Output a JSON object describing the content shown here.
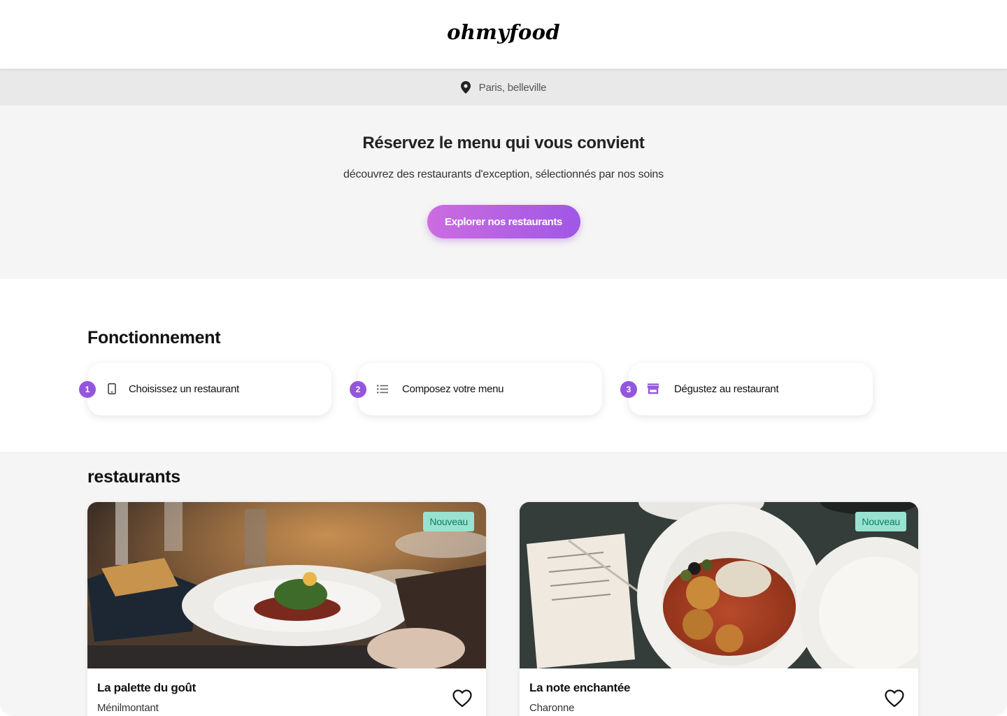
{
  "header": {
    "logo": "ohmyfood"
  },
  "location": {
    "text": "Paris, belleville",
    "icon": "location-pin-icon"
  },
  "hero": {
    "title": "Réservez le menu qui vous convient",
    "subtitle": "découvrez des restaurants d'exception, sélectionnés par nos soins",
    "cta": "Explorer nos restaurants"
  },
  "how": {
    "title": "Fonctionnement",
    "steps": [
      {
        "number": "1",
        "icon": "phone-icon",
        "label": "Choisissez un restaurant"
      },
      {
        "number": "2",
        "icon": "list-icon",
        "label": "Composez votre menu"
      },
      {
        "number": "3",
        "icon": "store-icon",
        "label": "Dégustez au restaurant"
      }
    ]
  },
  "restaurants": {
    "title": "restaurants",
    "items": [
      {
        "name": "La palette du goût",
        "location": "Ménilmontant",
        "badge": "Nouveau",
        "favorite_icon": "heart-icon"
      },
      {
        "name": "La note enchantée",
        "location": "Charonne",
        "badge": "Nouveau",
        "favorite_icon": "heart-icon"
      }
    ]
  },
  "colors": {
    "accent": "#9356dc",
    "button_start": "#cc6ce0",
    "button_end": "#9f57e6",
    "badge_bg": "#99e2d0",
    "badge_text": "#0f7d62"
  }
}
